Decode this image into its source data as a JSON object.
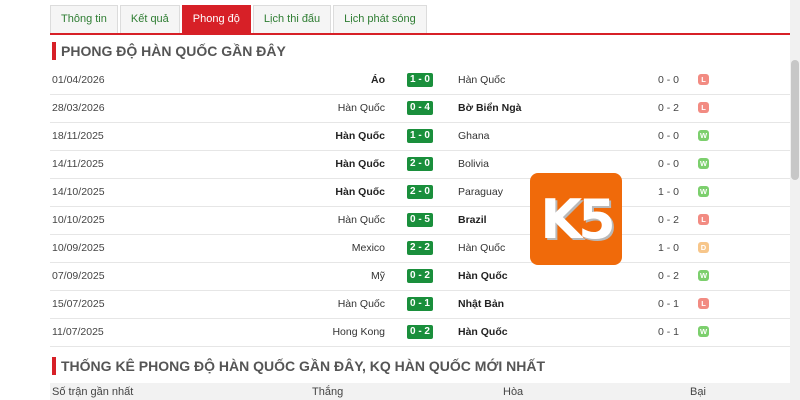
{
  "tabs": [
    "Thông tin",
    "Kết quả",
    "Phong độ",
    "Lịch thi đấu",
    "Lịch phát sóng"
  ],
  "active_tab": "Phong độ",
  "section1_title": "PHONG ĐỘ HÀN QUỐC GẦN ĐÂY",
  "matches": [
    {
      "date": "01/04/2026",
      "home": "Áo",
      "score": "1 - 0",
      "away": "Hàn Quốc",
      "ht": "0 - 0",
      "result": "L",
      "home_bold": true,
      "away_bold": false
    },
    {
      "date": "28/03/2026",
      "home": "Hàn Quốc",
      "score": "0 - 4",
      "away": "Bờ Biển Ngà",
      "ht": "0 - 2",
      "result": "L",
      "home_bold": false,
      "away_bold": true
    },
    {
      "date": "18/11/2025",
      "home": "Hàn Quốc",
      "score": "1 - 0",
      "away": "Ghana",
      "ht": "0 - 0",
      "result": "W",
      "home_bold": true,
      "away_bold": false
    },
    {
      "date": "14/11/2025",
      "home": "Hàn Quốc",
      "score": "2 - 0",
      "away": "Bolivia",
      "ht": "0 - 0",
      "result": "W",
      "home_bold": true,
      "away_bold": false
    },
    {
      "date": "14/10/2025",
      "home": "Hàn Quốc",
      "score": "2 - 0",
      "away": "Paraguay",
      "ht": "1 - 0",
      "result": "W",
      "home_bold": true,
      "away_bold": false
    },
    {
      "date": "10/10/2025",
      "home": "Hàn Quốc",
      "score": "0 - 5",
      "away": "Brazil",
      "ht": "0 - 2",
      "result": "L",
      "home_bold": false,
      "away_bold": true
    },
    {
      "date": "10/09/2025",
      "home": "Mexico",
      "score": "2 - 2",
      "away": "Hàn Quốc",
      "ht": "1 - 0",
      "result": "D",
      "home_bold": false,
      "away_bold": false
    },
    {
      "date": "07/09/2025",
      "home": "Mỹ",
      "score": "0 - 2",
      "away": "Hàn Quốc",
      "ht": "0 - 2",
      "result": "W",
      "home_bold": false,
      "away_bold": true
    },
    {
      "date": "15/07/2025",
      "home": "Hàn Quốc",
      "score": "0 - 1",
      "away": "Nhật Bản",
      "ht": "0 - 1",
      "result": "L",
      "home_bold": false,
      "away_bold": true
    },
    {
      "date": "11/07/2025",
      "home": "Hong Kong",
      "score": "0 - 2",
      "away": "Hàn Quốc",
      "ht": "0 - 1",
      "result": "W",
      "home_bold": false,
      "away_bold": true
    }
  ],
  "logo_text": "K5",
  "section2_title": "THỐNG KÊ PHONG ĐỘ HÀN QUỐC GẦN ĐÂY, KQ HÀN QUỐC MỚI NHẤT",
  "stats_header": {
    "col1": "Số trận gần nhất",
    "col2": "Thắng",
    "col3": "Hòa",
    "col4": "Bại"
  },
  "colors": {
    "accent": "#d72027",
    "score_bg": "#1a8f3c",
    "win": "#7ccf6d",
    "loss": "#f28b82",
    "draw": "#f7c68a",
    "logo": "#f06a0a"
  }
}
